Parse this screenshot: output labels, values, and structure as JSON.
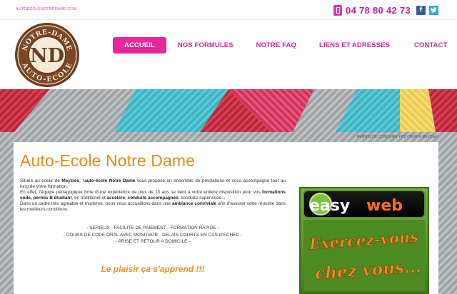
{
  "topbar": {
    "email": "AUTOECOLENOTREDAME.COM",
    "phone": "04 78 80 42 73",
    "facebook_glyph": "f",
    "twitter_glyph": "t"
  },
  "logo": {
    "top_text": "NOTRE-DAME",
    "monogram": "ND",
    "bottom_text": "AUTO-ECOLE"
  },
  "nav": [
    {
      "label": "ACCUEIL",
      "active": true
    },
    {
      "label": "NOS FORMULES",
      "active": false
    },
    {
      "label": "NOTRE FAQ",
      "active": false
    },
    {
      "label": "LIENS ET ADRESSES",
      "active": false
    },
    {
      "label": "CONTACT",
      "active": false
    }
  ],
  "breadcrumb": "PERMIS DE CONDUIRE PAS CHER À MEYZIEU",
  "content": {
    "title": "Auto-Ecole Notre Dame",
    "p1_a": "Située au coeur de ",
    "p1_b": "Meyzieu",
    "p1_c": ", l'",
    "p1_d": "auto-école Notre Dame",
    "p1_e": " vous propose un ensemble de prestations et vous accompagne tout au long de votre formation.",
    "p2_a": "En effet, l'équipe pédagogique forte d'une expérience de plus de 10 ans se tient à votre entière disposition pour vos ",
    "p2_b": "formations code, permis B étudiant",
    "p2_c": ", en traditionel et ",
    "p2_d": "accéléré",
    "p2_e": ", ",
    "p2_f": "conduite accompagnée",
    "p2_g": ", conduite supervisée...",
    "p3_a": "Dans un cadre très agréable et moderne, nous vous accueillons dans une ",
    "p3_b": "ambiance conviviale",
    "p3_c": " afin d'assurer votre réussite dans les meilleurs conditions.",
    "list": [
      "- SERIEUX - FACILITE DE PAIEMENT - FORMATION RAPIDE -",
      "- COURS DE CODE ORAL AVEC MONITEUR - DELAIS COURTS EN CAS D'ECHEC -",
      "- PRISE ET RETOUR A DOMICILE -"
    ],
    "slogan": "Le plaisir ça s'apprend !!!"
  },
  "ad": {
    "brand_a": "easy",
    "brand_b": "web",
    "line1": "Exercez-vous",
    "line2": "chez vous..."
  },
  "colors": {
    "accent": "#e8289a",
    "title": "#e8891b",
    "phone": "#c81f9e"
  }
}
